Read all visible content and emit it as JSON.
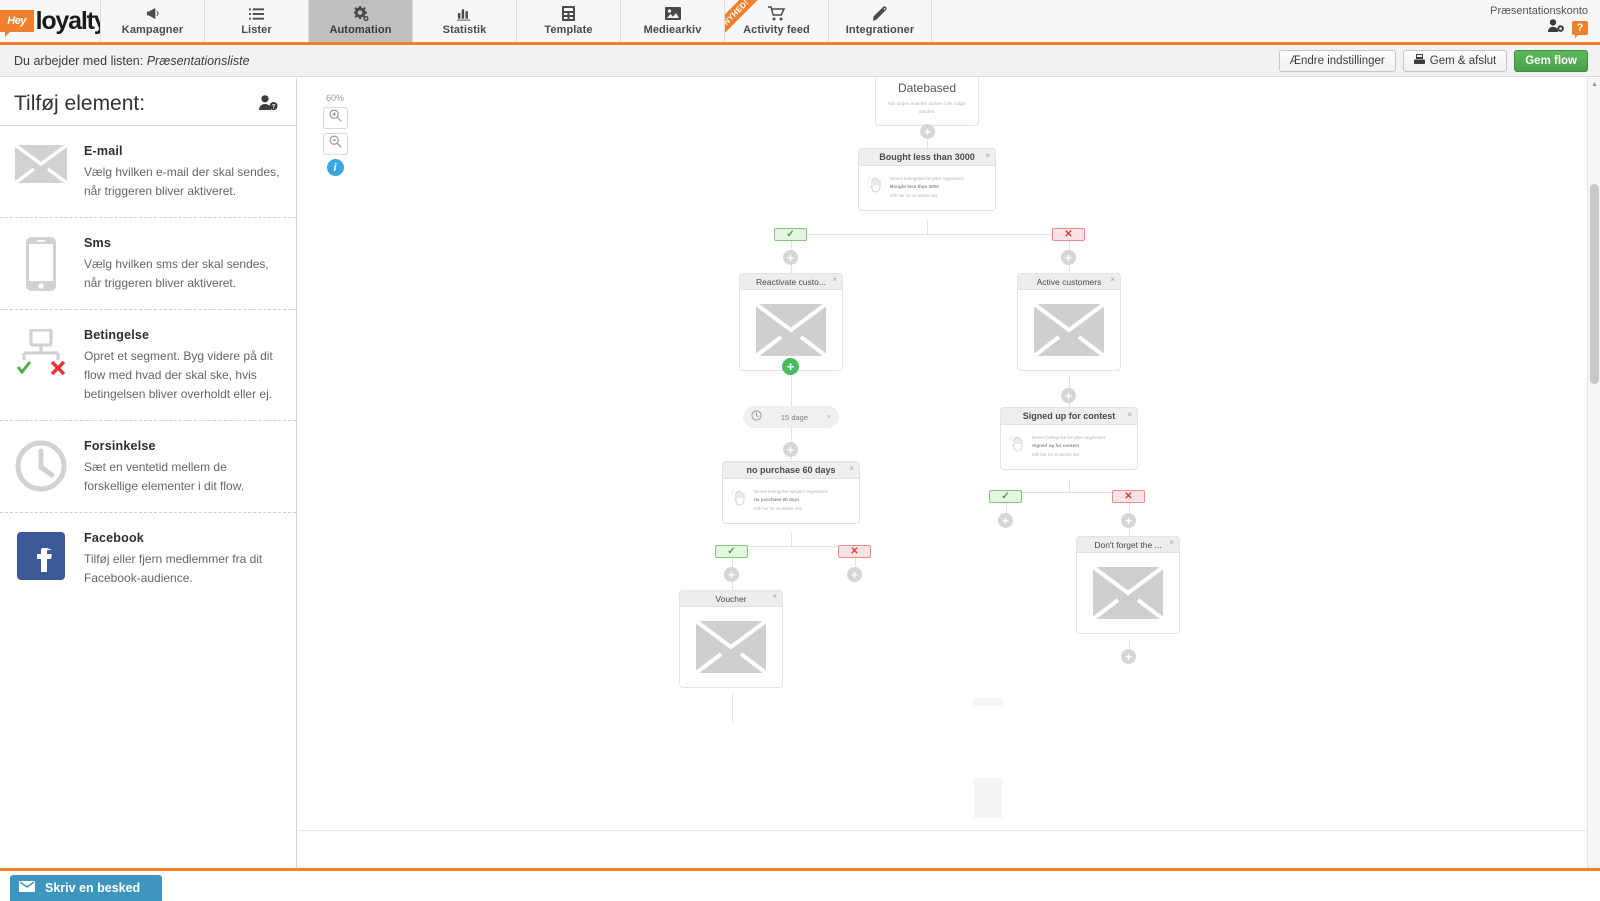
{
  "topnav": {
    "logo_mark_text": "Hey",
    "logo_word": "loyalty",
    "tabs": [
      {
        "label": "Kampagner",
        "icon": "megaphone-icon",
        "active": false,
        "ribbon": ""
      },
      {
        "label": "Lister",
        "icon": "list-icon",
        "active": false,
        "ribbon": ""
      },
      {
        "label": "Automation",
        "icon": "gear-icon",
        "active": true,
        "ribbon": ""
      },
      {
        "label": "Statistik",
        "icon": "bar-chart-icon",
        "active": false,
        "ribbon": ""
      },
      {
        "label": "Template",
        "icon": "template-icon",
        "active": false,
        "ribbon": ""
      },
      {
        "label": "Mediearkiv",
        "icon": "image-icon",
        "active": false,
        "ribbon": ""
      },
      {
        "label": "Activity feed",
        "icon": "cart-icon",
        "active": false,
        "ribbon": "NYHED!"
      },
      {
        "label": "Integrationer",
        "icon": "plug-icon",
        "active": false,
        "ribbon": ""
      }
    ],
    "account_name": "Præsentationskonto",
    "help_badge": "?",
    "accent_color": "#f0802b"
  },
  "subheader": {
    "label": "Du arbejder med listen:",
    "list_name": "Præsentationsliste",
    "buttons": {
      "settings": "Ændre indstillinger",
      "save_exit": "Gem & afslut",
      "save_flow": "Gem flow"
    },
    "primary_color": "#5cb85c"
  },
  "sidebar": {
    "title": "Tilføj element:",
    "help_icon": "user-help-icon",
    "items": [
      {
        "name": "E-mail",
        "icon": "envelope-icon",
        "desc": "Vælg hvilken e-mail der skal sendes, når triggeren bliver aktiveret."
      },
      {
        "name": "Sms",
        "icon": "phone-icon",
        "desc": "Vælg hvilken sms der skal sendes, når triggeren bliver aktiveret."
      },
      {
        "name": "Betingelse",
        "icon": "condition-branch-icon",
        "desc": "Opret et segment. Byg videre på dit flow med hvad der skal ske, hvis betingelsen bliver overholdt eller ej."
      },
      {
        "name": "Forsinkelse",
        "icon": "clock-icon",
        "desc": "Sæt en ventetid mellem de forskellige elementer i dit flow."
      },
      {
        "name": "Facebook",
        "icon": "facebook-icon",
        "desc": "Tilføj eller fjern medlemmer fra dit Facebook-audience."
      }
    ]
  },
  "canvas": {
    "zoom_level": "60%",
    "zoom_in_icon": "zoom-in-icon",
    "zoom_out_icon": "zoom-out-icon",
    "info_icon": "info-icon",
    "badge_yes": "✓",
    "badge_no": "✕",
    "plus_label": "+",
    "close_label": "×",
    "nodes": {
      "trigger": {
        "title": "Datebased",
        "subtitle": "Når dagen matcher datoen i det valgte datofelt."
      },
      "cond_bought": {
        "title": "Bought less than 3000",
        "line1": "Denne betingelse benytter segmentet:",
        "line2": "Bought less than 3000",
        "line3": "Klik her for at ændre det."
      },
      "mail_reactivate": {
        "title": "Reactivate custo..."
      },
      "mail_active": {
        "title": "Active customers"
      },
      "delay": {
        "title": "15 dage",
        "icon": "clock-icon"
      },
      "cond_nopurchase": {
        "title": "no purchase 60 days",
        "line1": "Denne betingelse benytter segmentet:",
        "line2": "no purchase 60 days",
        "line3": "Klik her for at ændre det."
      },
      "cond_contest": {
        "title": "Signed up for contest",
        "line1": "Denne betingelse benytter segmentet:",
        "line2": "Signed up for contest",
        "line3": "Klik her for at ændre det."
      },
      "mail_voucher": {
        "title": "Voucher"
      },
      "mail_dontforget": {
        "title": "Don't forget the ..."
      }
    }
  },
  "chat": {
    "label": "Skriv en besked",
    "icon": "envelope-icon",
    "color": "#3e95bd"
  }
}
